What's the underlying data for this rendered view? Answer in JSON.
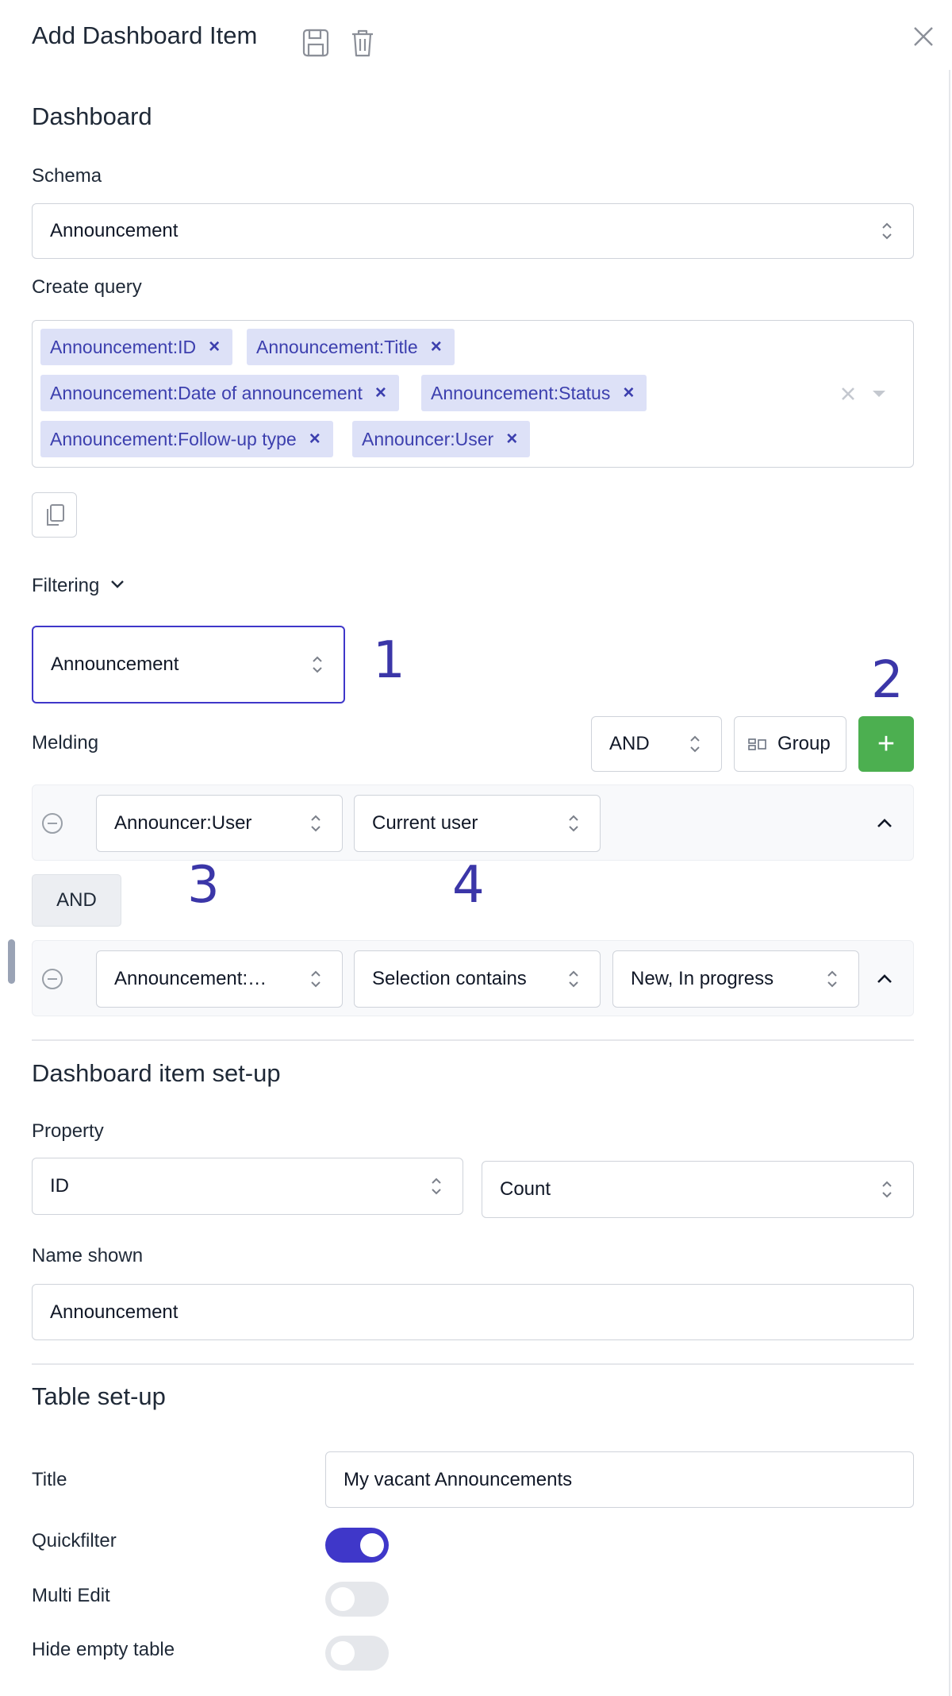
{
  "header": {
    "title": "Add Dashboard Item"
  },
  "dashboard": {
    "heading": "Dashboard",
    "schema_label": "Schema",
    "schema_value": "Announcement",
    "query_label": "Create query",
    "query_chips": [
      "Announcement:ID",
      "Announcement:Title",
      "Announcement:Date of announcement",
      "Announcement:Status",
      "Announcement:Follow-up type",
      "Announcer:User"
    ]
  },
  "filtering": {
    "label": "Filtering",
    "entity_value": "Announcement",
    "melding_label": "Melding",
    "operator_value": "AND",
    "group_label": "Group",
    "add_label": "+",
    "rows": [
      {
        "field": "Announcer:User",
        "operator": "Current user"
      },
      {
        "field": "Announcement:…",
        "operator": "Selection contains",
        "value": "New, In progress"
      }
    ],
    "connector": "AND"
  },
  "annotations": {
    "a1": "1",
    "a2": "2",
    "a3": "3",
    "a4": "4"
  },
  "setup": {
    "heading": "Dashboard item set-up",
    "property_label": "Property",
    "property_value": "ID",
    "aggregate_value": "Count",
    "name_label": "Name shown",
    "name_value": "Announcement"
  },
  "table": {
    "heading": "Table set-up",
    "title_label": "Title",
    "title_value": "My vacant Announcements",
    "toggles": [
      {
        "label": "Quickfilter",
        "value": 1
      },
      {
        "label": "Multi Edit",
        "value": 0
      },
      {
        "label": "Hide empty table",
        "value": 0
      }
    ]
  },
  "colors": {
    "accent": "#3f37c9",
    "chip_bg": "#dde1f7",
    "chip_text": "#3c3fae",
    "add_button": "#4caf50",
    "annotation": "#3b36a8"
  },
  "icons": {
    "save": "floppy-disk-icon",
    "delete": "trash-icon",
    "close": "close-icon",
    "copy": "copy-icon",
    "collapse": "chevron-up-icon",
    "remove_row": "minus-circle-icon"
  }
}
